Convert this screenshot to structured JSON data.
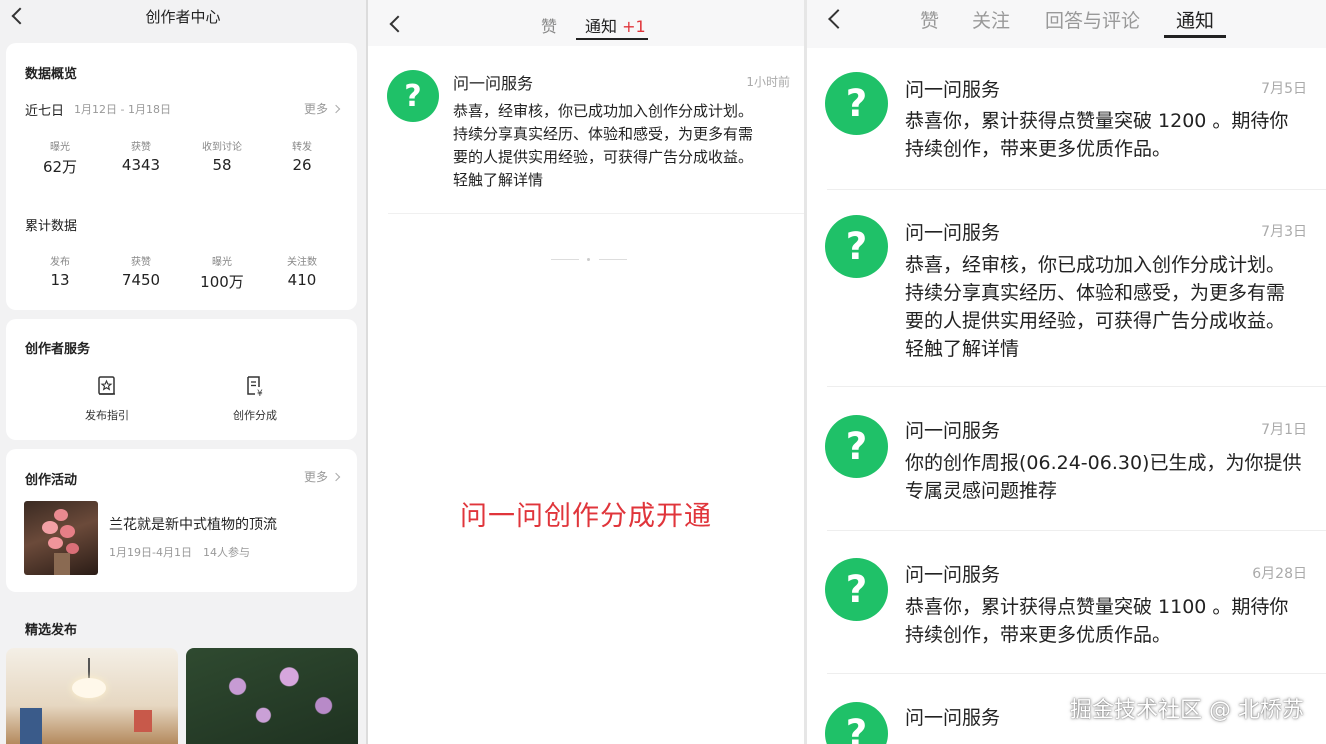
{
  "creator_center": {
    "title": "创作者中心",
    "overview": {
      "heading": "数据概览",
      "period_label": "近七日",
      "period_range": "1月12日 - 1月18日",
      "more": "更多",
      "week_stats": [
        {
          "label": "曝光",
          "value": "62万"
        },
        {
          "label": "获赞",
          "value": "4343"
        },
        {
          "label": "收到讨论",
          "value": "58"
        },
        {
          "label": "转发",
          "value": "26"
        }
      ],
      "total_heading": "累计数据",
      "total_stats": [
        {
          "label": "发布",
          "value": "13"
        },
        {
          "label": "获赞",
          "value": "7450"
        },
        {
          "label": "曝光",
          "value": "100万"
        },
        {
          "label": "关注数",
          "value": "410"
        }
      ]
    },
    "services": {
      "heading": "创作者服务",
      "items": [
        {
          "label": "发布指引",
          "icon": "publish-guide-icon"
        },
        {
          "label": "创作分成",
          "icon": "revenue-share-icon"
        }
      ]
    },
    "activities": {
      "heading": "创作活动",
      "more": "更多",
      "item_title": "兰花就是新中式植物的顶流",
      "item_date": "1月19日-4月1日",
      "item_participants": "14人参与"
    },
    "featured": {
      "heading": "精选发布"
    }
  },
  "middle_panel": {
    "tabs": [
      {
        "label": "赞"
      },
      {
        "label": "通知",
        "badge": "+1"
      }
    ],
    "notification": {
      "sender": "问一问服务",
      "time": "1小时前",
      "lines": [
        "恭喜，经审核，你已成功加入创作分成计划。",
        "持续分享真实经历、体验和感受，为更多有需",
        "要的人提供实用经验，可获得广告分成收益。",
        "轻触了解详情"
      ]
    },
    "caption": "问一问创作分成开通"
  },
  "right_panel": {
    "tabs": [
      {
        "label": "赞"
      },
      {
        "label": "关注"
      },
      {
        "label": "回答与评论"
      },
      {
        "label": "通知"
      }
    ],
    "notifications": [
      {
        "sender": "问一问服务",
        "date": "7月5日",
        "lines": [
          "恭喜你，累计获得点赞量突破 1200 。期待你",
          "持续创作，带来更多优质作品。"
        ]
      },
      {
        "sender": "问一问服务",
        "date": "7月3日",
        "lines": [
          "恭喜，经审核，你已成功加入创作分成计划。",
          "持续分享真实经历、体验和感受，为更多有需",
          "要的人提供实用经验，可获得广告分成收益。",
          "轻触了解详情"
        ]
      },
      {
        "sender": "问一问服务",
        "date": "7月1日",
        "lines": [
          "你的创作周报(06.24-06.30)已生成，为你提供",
          "专属灵感问题推荐"
        ]
      },
      {
        "sender": "问一问服务",
        "date": "6月28日",
        "lines": [
          "恭喜你，累计获得点赞量突破 1100 。期待你",
          "持续创作，带来更多优质作品。"
        ]
      },
      {
        "sender": "问一问服务",
        "date": "",
        "lines": []
      }
    ],
    "watermark": "掘金技术社区 @ 北桥苏"
  },
  "colors": {
    "accent_green": "#1fc168",
    "badge_red": "#e0353b"
  }
}
